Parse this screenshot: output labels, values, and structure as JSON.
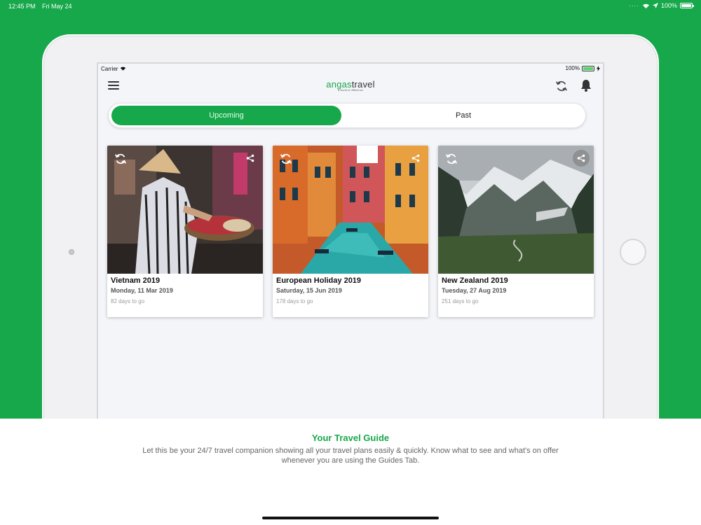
{
  "os_status": {
    "time": "12:45 PM",
    "date": "Fri May 24",
    "battery": "100%"
  },
  "app_status": {
    "carrier": "Carrier",
    "battery": "100%"
  },
  "header": {
    "logo_main": "angas",
    "logo_accent": "travel",
    "logo_tagline": "a world of difference"
  },
  "segments": {
    "upcoming": "Upcoming",
    "past": "Past",
    "selected": "Upcoming"
  },
  "trips": [
    {
      "title": "Vietnam 2019",
      "date": "Monday, 11 Mar 2019",
      "countdown": "82 days to go"
    },
    {
      "title": "European Holiday 2019",
      "date": "Saturday, 15 Jun 2019",
      "countdown": "178 days to go"
    },
    {
      "title": "New Zealand 2019",
      "date": "Tuesday, 27 Aug 2019",
      "countdown": "251 days to go"
    }
  ],
  "promo": {
    "title": "Your Travel Guide",
    "description": "Let this be your 24/7 travel companion showing all your travel plans easily & quickly. Know what to see and what's on offer whenever you are using the Guides Tab."
  },
  "colors": {
    "brand": "#16a84a",
    "background": "#f4f5f9"
  }
}
